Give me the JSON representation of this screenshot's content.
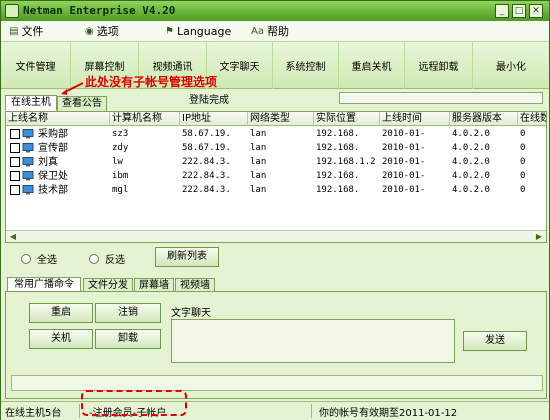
{
  "window": {
    "title": "Netman Enterprise V4.20",
    "minimize": "_",
    "maximize": "□",
    "close": "✕"
  },
  "menu": [
    {
      "label": "文件",
      "icon": "file-icon"
    },
    {
      "label": "选项",
      "icon": "options-icon"
    },
    {
      "label": "Language",
      "icon": "language-icon"
    },
    {
      "label": "帮助",
      "icon": "help-icon"
    }
  ],
  "toolbar": [
    "文件管理",
    "屏幕控制",
    "视频通讯",
    "文字聊天",
    "系统控制",
    "重启关机",
    "远程卸载",
    "最小化"
  ],
  "annotation": "此处没有子帐号管理选项",
  "tabs_top": [
    "在线主机",
    "查看公告"
  ],
  "status_top": "登陆完成",
  "table": {
    "headers": [
      "上线名称",
      "计算机名称",
      "IP地址",
      "网络类型",
      "实际位置",
      "上线时间",
      "服务器版本",
      "在线数"
    ],
    "rows": [
      [
        "采购部",
        "sz3",
        "58.67.19.",
        "lan",
        "192.168.",
        "2010-01-",
        "4.0.2.0",
        "0"
      ],
      [
        "宣传部",
        "zdy",
        "58.67.19.",
        "lan",
        "192.168.",
        "2010-01-",
        "4.0.2.0",
        "0"
      ],
      [
        "刘真",
        "lw",
        "222.84.3.",
        "lan",
        "192.168.1.2",
        "2010-01-",
        "4.0.2.0",
        "0"
      ],
      [
        "保卫处",
        "ibm",
        "222.84.3.",
        "lan",
        "192.168.",
        "2010-01-",
        "4.0.2.0",
        "0"
      ],
      [
        "技术部",
        "mgl",
        "222.84.3.",
        "lan",
        "192.168.",
        "2010-01-",
        "4.0.2.0",
        "0"
      ]
    ]
  },
  "controls": {
    "select_all": "全选",
    "invert": "反选",
    "refresh": "刷新列表"
  },
  "tabs_bottom": [
    "常用广播命令",
    "文件分发",
    "屏幕墙",
    "视频墙"
  ],
  "commands": {
    "restart": "重启",
    "logout": "注销",
    "shutdown": "关机",
    "uninstall": "卸载",
    "chat_label": "文字聊天",
    "send": "发送"
  },
  "statusbar": {
    "hosts": "在线主机5台",
    "member": "-注册会员-子帐户",
    "expiry": "你的帐号有效期至2011-01-12"
  },
  "colors": {
    "accent_red": "#e10000",
    "frame_green": "#4f9a22"
  }
}
